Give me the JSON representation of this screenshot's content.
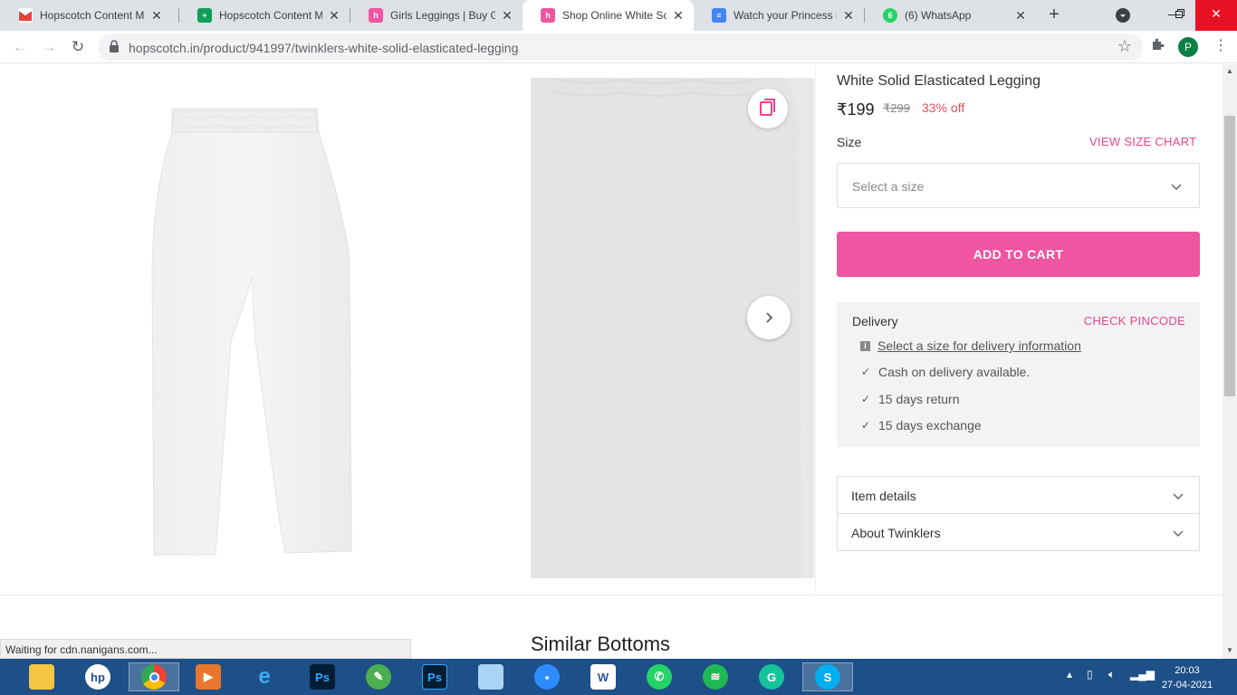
{
  "browser": {
    "tabs": [
      {
        "title": "Hopscotch Content Ma",
        "icon": "gmail-icon",
        "active": false
      },
      {
        "title": "Hopscotch Content Ma",
        "icon": "sheets-icon",
        "active": false
      },
      {
        "title": "Girls Leggings | Buy Girl",
        "icon": "hopscotch-icon",
        "active": false
      },
      {
        "title": "Shop Online White Soli",
        "icon": "hopscotch-icon",
        "active": true
      },
      {
        "title": "Watch your Princess Pu",
        "icon": "docs-icon",
        "active": false
      },
      {
        "title": "(6) WhatsApp",
        "icon": "whatsapp-icon",
        "active": false
      }
    ],
    "url": "hopscotch.in/product/941997/twinklers-white-solid-elasticated-legging",
    "profile_initial": "P",
    "status": "Waiting for cdn.nanigans.com..."
  },
  "product": {
    "title": "White Solid Elasticated Legging",
    "price": "₹199",
    "mrp": "₹299",
    "discount": "33% off",
    "size_label": "Size",
    "size_chart": "VIEW SIZE CHART",
    "size_placeholder": "Select a size",
    "add_to_cart": "ADD TO CART"
  },
  "delivery": {
    "title": "Delivery",
    "check_pincode": "CHECK PINCODE",
    "info_link": "Select a size for delivery information",
    "items": [
      "Cash on delivery available.",
      "15 days return",
      "15 days exchange"
    ]
  },
  "accordions": [
    {
      "label": "Item details"
    },
    {
      "label": "About Twinklers"
    }
  ],
  "similar_heading": "Similar Bottoms",
  "taskbar": {
    "time": "20:03",
    "date": "27-04-2021",
    "apps": [
      "file-explorer-icon",
      "hp-icon",
      "chrome-icon",
      "media-player-icon",
      "internet-explorer-icon",
      "photoshop-icon",
      "greenshot-icon",
      "photoshop-icon",
      "notepad-icon",
      "zoom-icon",
      "word-icon",
      "whatsapp-icon",
      "spotify-icon",
      "grammarly-icon",
      "skype-icon"
    ]
  },
  "colors": {
    "accent": "#ef55a1",
    "link_pink": "#e8448d",
    "discount": "#e8505b",
    "taskbar": "#1d4f88"
  }
}
